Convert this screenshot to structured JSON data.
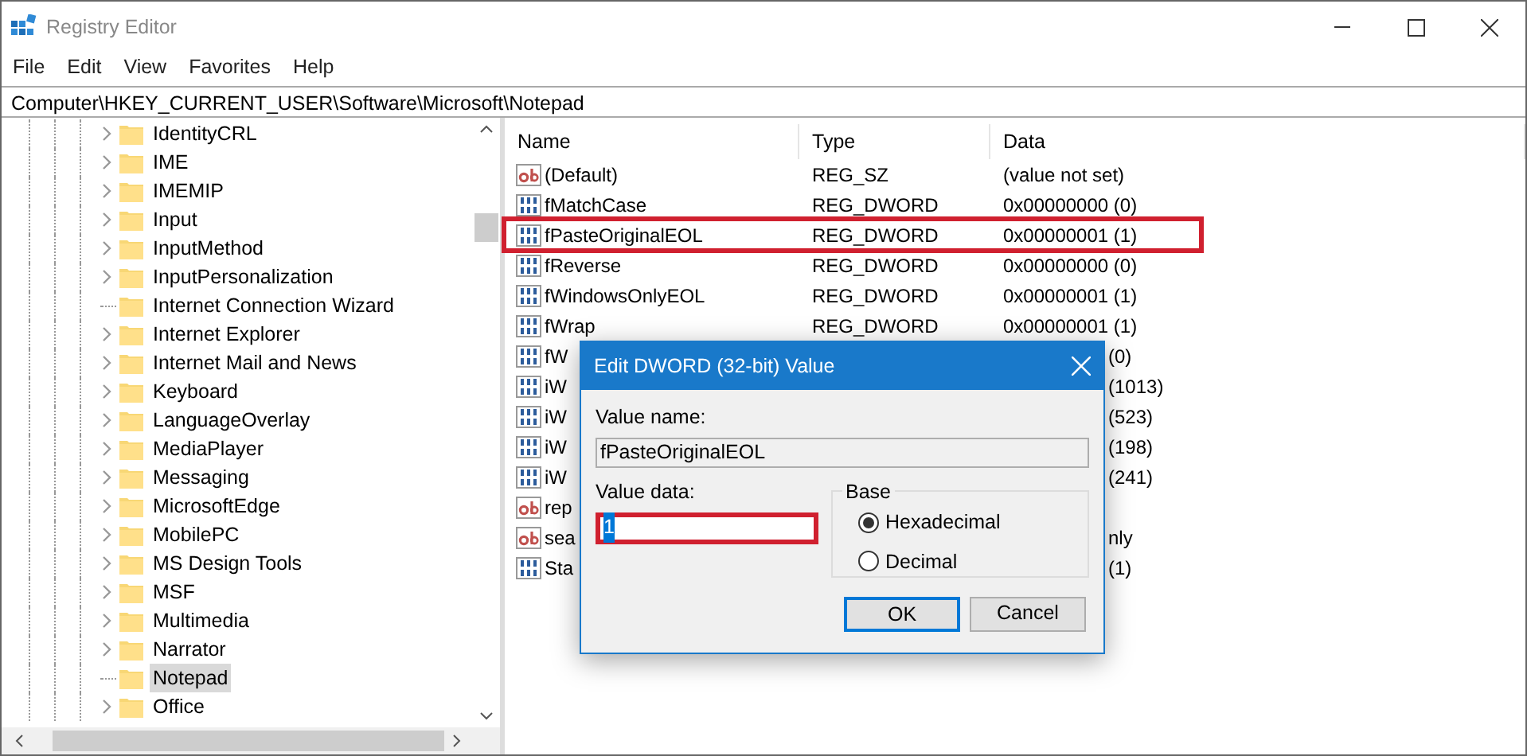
{
  "window": {
    "title": "Registry Editor"
  },
  "menu": [
    "File",
    "Edit",
    "View",
    "Favorites",
    "Help"
  ],
  "address": "Computer\\HKEY_CURRENT_USER\\Software\\Microsoft\\Notepad",
  "tree": [
    {
      "label": "IdentityCRL",
      "expandable": true,
      "selected": false
    },
    {
      "label": "IME",
      "expandable": true,
      "selected": false
    },
    {
      "label": "IMEMIP",
      "expandable": true,
      "selected": false
    },
    {
      "label": "Input",
      "expandable": true,
      "selected": false
    },
    {
      "label": "InputMethod",
      "expandable": true,
      "selected": false
    },
    {
      "label": "InputPersonalization",
      "expandable": true,
      "selected": false
    },
    {
      "label": "Internet Connection Wizard",
      "expandable": false,
      "selected": false
    },
    {
      "label": "Internet Explorer",
      "expandable": true,
      "selected": false
    },
    {
      "label": "Internet Mail and News",
      "expandable": true,
      "selected": false
    },
    {
      "label": "Keyboard",
      "expandable": true,
      "selected": false
    },
    {
      "label": "LanguageOverlay",
      "expandable": true,
      "selected": false
    },
    {
      "label": "MediaPlayer",
      "expandable": true,
      "selected": false
    },
    {
      "label": "Messaging",
      "expandable": true,
      "selected": false
    },
    {
      "label": "MicrosoftEdge",
      "expandable": true,
      "selected": false
    },
    {
      "label": "MobilePC",
      "expandable": true,
      "selected": false
    },
    {
      "label": "MS Design Tools",
      "expandable": true,
      "selected": false
    },
    {
      "label": "MSF",
      "expandable": true,
      "selected": false
    },
    {
      "label": "Multimedia",
      "expandable": true,
      "selected": false
    },
    {
      "label": "Narrator",
      "expandable": true,
      "selected": false
    },
    {
      "label": "Notepad",
      "expandable": false,
      "selected": true
    },
    {
      "label": "Office",
      "expandable": true,
      "selected": false
    }
  ],
  "list": {
    "columns": [
      "Name",
      "Type",
      "Data"
    ],
    "rows": [
      {
        "kind": "string",
        "name": "(Default)",
        "type": "REG_SZ",
        "data": "(value not set)",
        "highlighted": false
      },
      {
        "kind": "binary",
        "name": "fMatchCase",
        "type": "REG_DWORD",
        "data": "0x00000000 (0)",
        "highlighted": false
      },
      {
        "kind": "binary",
        "name": "fPasteOriginalEOL",
        "type": "REG_DWORD",
        "data": "0x00000001 (1)",
        "highlighted": true
      },
      {
        "kind": "binary",
        "name": "fReverse",
        "type": "REG_DWORD",
        "data": "0x00000000 (0)",
        "highlighted": false
      },
      {
        "kind": "binary",
        "name": "fWindowsOnlyEOL",
        "type": "REG_DWORD",
        "data": "0x00000001 (1)",
        "highlighted": false
      },
      {
        "kind": "binary",
        "name": "fWrap",
        "type": "REG_DWORD",
        "data": "0x00000001 (1)",
        "highlighted": false
      },
      {
        "kind": "binary",
        "name": "fW",
        "data": "(0)",
        "highlighted": false
      },
      {
        "kind": "binary",
        "name": "iW",
        "data": "(1013)",
        "highlighted": false
      },
      {
        "kind": "binary",
        "name": "iW",
        "data": "(523)",
        "highlighted": false
      },
      {
        "kind": "binary",
        "name": "iW",
        "data": "(198)",
        "highlighted": false
      },
      {
        "kind": "binary",
        "name": "iW",
        "data": "(241)",
        "highlighted": false
      },
      {
        "kind": "string",
        "name": "rep",
        "highlighted": false
      },
      {
        "kind": "string",
        "name": "sea",
        "data": "nly",
        "highlighted": false
      },
      {
        "kind": "binary",
        "name": "Sta",
        "data": "(1)",
        "highlighted": false
      }
    ]
  },
  "dialog": {
    "title": "Edit DWORD (32-bit) Value",
    "value_name_label": "Value name:",
    "value_name": "fPasteOriginalEOL",
    "value_data_label": "Value data:",
    "value_data": "1",
    "value_data_selected": true,
    "value_data_highlighted": true,
    "base_label": "Base",
    "radios": [
      {
        "label": "Hexadecimal",
        "selected": true
      },
      {
        "label": "Decimal",
        "selected": false
      }
    ],
    "buttons": [
      {
        "label": "OK",
        "default": true
      },
      {
        "label": "Cancel",
        "default": false
      }
    ]
  }
}
